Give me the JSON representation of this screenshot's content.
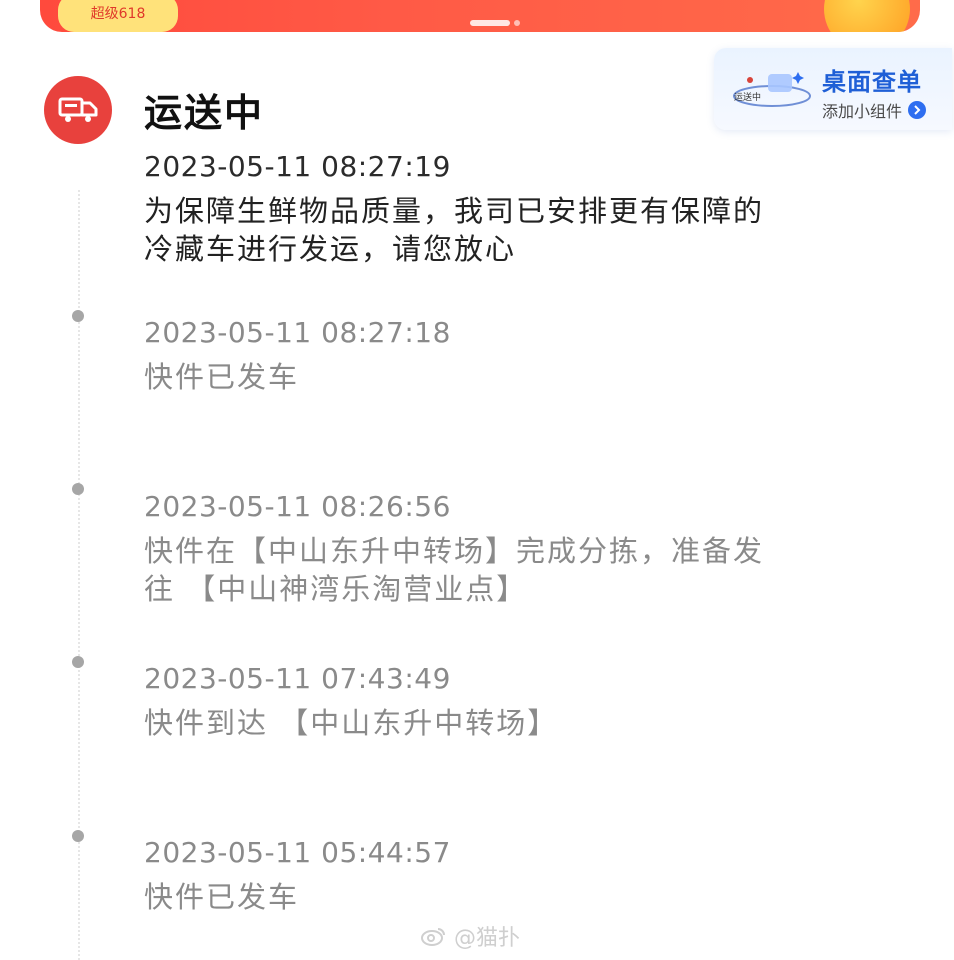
{
  "banner": {
    "badge_text": "超级618"
  },
  "widget": {
    "title": "桌面查单",
    "subtitle": "添加小组件",
    "mini_label": "运送中"
  },
  "status": {
    "title": "运送中",
    "accent": "#e8413d"
  },
  "events": [
    {
      "time": "2023-05-11 08:27:19",
      "desc_lines": [
        "为保障生鲜物品质量，我司已安排更有保障的",
        "冷藏车进行发运，请您放心"
      ]
    },
    {
      "time": "2023-05-11 08:27:18",
      "desc_lines": [
        "快件已发车"
      ]
    },
    {
      "time": "2023-05-11 08:26:56",
      "desc_lines": [
        "快件在【中山东升中转场】完成分拣，准备发",
        "往 【中山神湾乐淘营业点】"
      ]
    },
    {
      "time": "2023-05-11 07:43:49",
      "desc_lines": [
        "快件到达 【中山东升中转场】"
      ]
    },
    {
      "time": "2023-05-11 05:44:57",
      "desc_lines": [
        "快件已发车"
      ]
    }
  ],
  "watermark": {
    "text": "@猫扑"
  }
}
